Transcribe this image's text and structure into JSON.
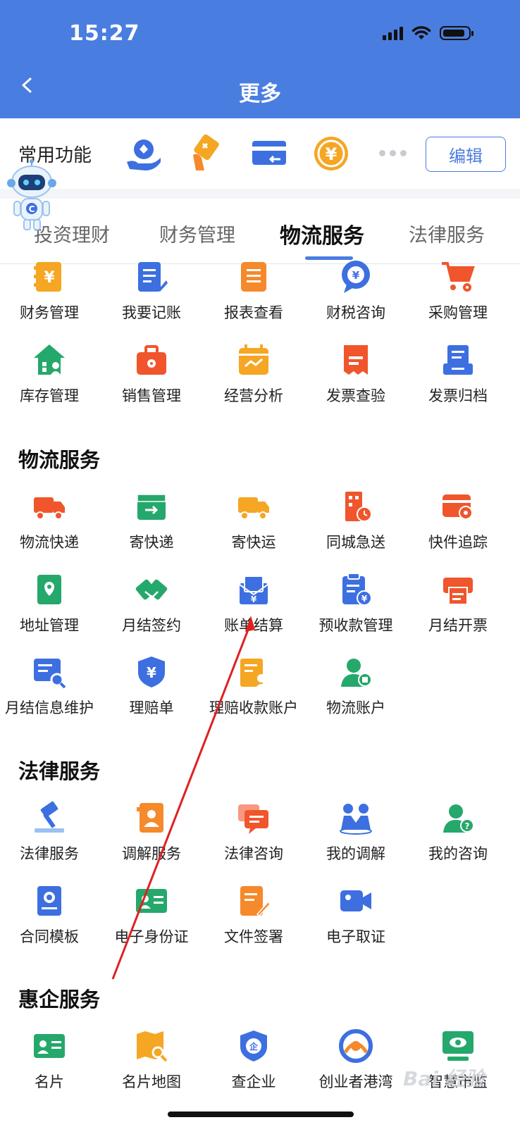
{
  "status_bar": {
    "time": "15:27"
  },
  "header": {
    "title": "更多"
  },
  "favorites": {
    "label": "常用功能",
    "edit_label": "编辑",
    "icons": [
      "hand-user-icon",
      "hand-card-icon",
      "card-transfer-icon",
      "yuan-coin-icon"
    ]
  },
  "tabs": [
    {
      "label": "投资理财",
      "active": false
    },
    {
      "label": "财务管理",
      "active": false
    },
    {
      "label": "物流服务",
      "active": true
    },
    {
      "label": "法律服务",
      "active": false
    }
  ],
  "finance": {
    "items": [
      {
        "label": "财务管理",
        "icon": "yuan-ledger-icon",
        "color": "#f5a623"
      },
      {
        "label": "我要记账",
        "icon": "notebook-pen-icon",
        "color": "#3d6fe0"
      },
      {
        "label": "报表查看",
        "icon": "report-icon",
        "color": "#f5892b"
      },
      {
        "label": "财税咨询",
        "icon": "tax-chat-icon",
        "color": "#3d6fe0"
      },
      {
        "label": "采购管理",
        "icon": "cart-gear-icon",
        "color": "#f0552c"
      },
      {
        "label": "库存管理",
        "icon": "warehouse-icon",
        "color": "#25a86b"
      },
      {
        "label": "销售管理",
        "icon": "briefcase-gear-icon",
        "color": "#f0552c"
      },
      {
        "label": "经营分析",
        "icon": "calendar-chart-icon",
        "color": "#f5a623"
      },
      {
        "label": "发票查验",
        "icon": "invoice-check-icon",
        "color": "#f0552c"
      },
      {
        "label": "发票归档",
        "icon": "invoice-archive-icon",
        "color": "#3d6fe0"
      }
    ]
  },
  "logistics": {
    "title": "物流服务",
    "items": [
      {
        "label": "物流快递",
        "icon": "truck-icon",
        "color": "#f0552c"
      },
      {
        "label": "寄快递",
        "icon": "box-send-icon",
        "color": "#25a86b"
      },
      {
        "label": "寄快运",
        "icon": "fast-truck-icon",
        "color": "#f5a623"
      },
      {
        "label": "同城急送",
        "icon": "building-clock-icon",
        "color": "#f0552c"
      },
      {
        "label": "快件追踪",
        "icon": "parcel-track-icon",
        "color": "#f0552c"
      },
      {
        "label": "地址管理",
        "icon": "address-book-icon",
        "color": "#25a86b"
      },
      {
        "label": "月结签约",
        "icon": "handshake-icon",
        "color": "#25a86b"
      },
      {
        "label": "账单结算",
        "icon": "bill-envelope-icon",
        "color": "#3d6fe0"
      },
      {
        "label": "预收款管理",
        "icon": "prepay-clipboard-icon",
        "color": "#3d6fe0"
      },
      {
        "label": "月结开票",
        "icon": "printer-invoice-icon",
        "color": "#f0552c"
      },
      {
        "label": "月结信息维护",
        "icon": "info-search-icon",
        "color": "#3d6fe0"
      },
      {
        "label": "理赔单",
        "icon": "shield-yuan-icon",
        "color": "#3d6fe0"
      },
      {
        "label": "理赔收款账户",
        "icon": "claim-account-icon",
        "color": "#f5a623"
      },
      {
        "label": "物流账户",
        "icon": "user-box-icon",
        "color": "#25a86b"
      }
    ]
  },
  "legal": {
    "title": "法律服务",
    "items": [
      {
        "label": "法律服务",
        "icon": "gavel-icon",
        "color": "#3d6fe0"
      },
      {
        "label": "调解服务",
        "icon": "mediation-doc-icon",
        "color": "#f5892b"
      },
      {
        "label": "法律咨询",
        "icon": "chat-bubbles-icon",
        "color": "#f0552c"
      },
      {
        "label": "我的调解",
        "icon": "people-meet-icon",
        "color": "#3d6fe0"
      },
      {
        "label": "我的咨询",
        "icon": "user-question-icon",
        "color": "#25a86b"
      },
      {
        "label": "合同模板",
        "icon": "contract-badge-icon",
        "color": "#3d6fe0"
      },
      {
        "label": "电子身份证",
        "icon": "id-card-icon",
        "color": "#25a86b"
      },
      {
        "label": "文件签署",
        "icon": "file-sign-icon",
        "color": "#f5892b"
      },
      {
        "label": "电子取证",
        "icon": "video-camera-icon",
        "color": "#3d6fe0"
      }
    ]
  },
  "enterprise": {
    "title": "惠企服务",
    "items": [
      {
        "label": "名片",
        "icon": "business-card-icon",
        "color": "#25a86b"
      },
      {
        "label": "名片地图",
        "icon": "map-search-icon",
        "color": "#f5a623"
      },
      {
        "label": "查企业",
        "icon": "shield-company-icon",
        "color": "#3d6fe0"
      },
      {
        "label": "创业者港湾",
        "icon": "harbor-logo-icon",
        "color": "#3d6fe0"
      },
      {
        "label": "智慧市监",
        "icon": "monitor-eye-icon",
        "color": "#25a86b"
      }
    ]
  },
  "watermark": "Bai 经验"
}
